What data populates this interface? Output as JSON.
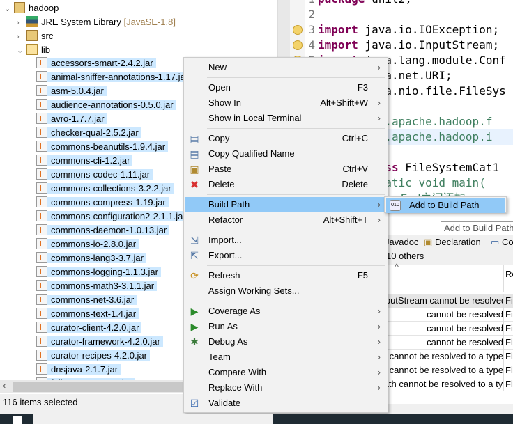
{
  "explorer": {
    "project": "hadoop",
    "jre": {
      "label": "JRE System Library",
      "suffix": "[JavaSE-1.8]"
    },
    "src": "src",
    "lib": "lib",
    "jars": [
      "accessors-smart-2.4.2.jar",
      "animal-sniffer-annotations-1.17.jar",
      "asm-5.0.4.jar",
      "audience-annotations-0.5.0.jar",
      "avro-1.7.7.jar",
      "checker-qual-2.5.2.jar",
      "commons-beanutils-1.9.4.jar",
      "commons-cli-1.2.jar",
      "commons-codec-1.11.jar",
      "commons-collections-3.2.2.jar",
      "commons-compress-1.19.jar",
      "commons-configuration2-2.1.1.jar",
      "commons-daemon-1.0.13.jar",
      "commons-io-2.8.0.jar",
      "commons-lang3-3.7.jar",
      "commons-logging-1.1.3.jar",
      "commons-math3-3.1.1.jar",
      "commons-net-3.6.jar",
      "commons-text-1.4.jar",
      "curator-client-4.2.0.jar",
      "curator-framework-4.2.0.jar",
      "curator-recipes-4.2.0.jar",
      "dnsjava-2.1.7.jar",
      "failureaccess-1.0.jar"
    ],
    "status": "116 items selected"
  },
  "editor": {
    "lines": [
      {
        "n": "1",
        "kw": "package",
        "rest": " unit2;"
      },
      {
        "n": "2",
        "kw": "",
        "rest": ""
      },
      {
        "n": "3",
        "kw": "import",
        "rest": " java.io.IOException;"
      },
      {
        "n": "4",
        "kw": "import",
        "rest": " java.io.InputStream;"
      },
      {
        "n": "5",
        "kw": "import",
        "rest": " java.lang.module.Conf"
      },
      {
        "n": "6",
        "kw": "import",
        "rest": " java.net.URI;"
      },
      {
        "n": "7",
        "kw": "import",
        "rest": " java.nio.file.FileSys"
      },
      {
        "n": "8",
        "kw": "",
        "rest": ""
      },
      {
        "n": "9",
        "kw": "import",
        "rest": " org.apache.hadoop.f"
      },
      {
        "n": "10",
        "kw": "import",
        "rest": " org.apache.hadoop.i"
      },
      {
        "n": "11",
        "kw": "",
        "rest": ""
      },
      {
        "n": "12",
        "kw": "public class",
        "rest": " FileSystemCat1"
      },
      {
        "n": "13",
        "kw": "",
        "rest": "  public static void main("
      },
      {
        "n": "14",
        "kw": "",
        "rest": "    //请在Begin-End之间添加"
      }
    ]
  },
  "bottom": {
    "tabs": [
      "Javadoc",
      "Declaration",
      "Console"
    ],
    "others": "10 others",
    "col2": "Re",
    "rows": [
      {
        "desc": "InputStream cannot be resolved t",
        "res": "Fil"
      },
      {
        "desc": "cannot be resolved",
        "res": "Fil"
      },
      {
        "desc": "cannot be resolved",
        "res": "Fil"
      },
      {
        "desc": "cannot be resolved",
        "res": "Fil"
      },
      {
        "desc": "cannot be resolved to a type",
        "res": "Fil"
      },
      {
        "desc": "cannot be resolved to a type",
        "res": "Fil"
      },
      {
        "desc": "Path cannot be resolved to a typ",
        "res": "Fil"
      }
    ]
  },
  "menu": {
    "items": [
      {
        "label": "New",
        "shortcut": "",
        "sub": true,
        "icon": ""
      },
      {
        "label": "Open",
        "shortcut": "F3",
        "sub": false,
        "icon": ""
      },
      {
        "label": "Show In",
        "shortcut": "Alt+Shift+W",
        "sub": true,
        "icon": ""
      },
      {
        "label": "Show in Local Terminal",
        "shortcut": "",
        "sub": true,
        "icon": ""
      },
      {
        "label": "Copy",
        "shortcut": "Ctrl+C",
        "sub": false,
        "icon": "copy-icon"
      },
      {
        "label": "Copy Qualified Name",
        "shortcut": "",
        "sub": false,
        "icon": "copy-qualified-icon"
      },
      {
        "label": "Paste",
        "shortcut": "Ctrl+V",
        "sub": false,
        "icon": "paste-icon"
      },
      {
        "label": "Delete",
        "shortcut": "Delete",
        "sub": false,
        "icon": "delete-icon"
      },
      {
        "label": "Build Path",
        "shortcut": "",
        "sub": true,
        "icon": ""
      },
      {
        "label": "Refactor",
        "shortcut": "Alt+Shift+T",
        "sub": true,
        "icon": ""
      },
      {
        "label": "Import...",
        "shortcut": "",
        "sub": false,
        "icon": "import-icon"
      },
      {
        "label": "Export...",
        "shortcut": "",
        "sub": false,
        "icon": "export-icon"
      },
      {
        "label": "Refresh",
        "shortcut": "F5",
        "sub": false,
        "icon": "refresh-icon"
      },
      {
        "label": "Assign Working Sets...",
        "shortcut": "",
        "sub": false,
        "icon": ""
      },
      {
        "label": "Coverage As",
        "shortcut": "",
        "sub": true,
        "icon": "coverage-icon"
      },
      {
        "label": "Run As",
        "shortcut": "",
        "sub": true,
        "icon": "run-icon"
      },
      {
        "label": "Debug As",
        "shortcut": "",
        "sub": true,
        "icon": "debug-icon"
      },
      {
        "label": "Team",
        "shortcut": "",
        "sub": true,
        "icon": ""
      },
      {
        "label": "Compare With",
        "shortcut": "",
        "sub": true,
        "icon": ""
      },
      {
        "label": "Replace With",
        "shortcut": "",
        "sub": true,
        "icon": ""
      },
      {
        "label": "Validate",
        "shortcut": "",
        "sub": false,
        "icon": "check-icon"
      }
    ],
    "active": "Build Path",
    "submenu": {
      "label": "Add to Build Path",
      "icon": "jar-icon"
    },
    "tooltip": "Add to Build Path"
  },
  "colors": {
    "selection": "#cce8ff",
    "menu_highlight": "#91c9f7",
    "keyword": "#7f0055",
    "comment": "#3f7f5f"
  }
}
